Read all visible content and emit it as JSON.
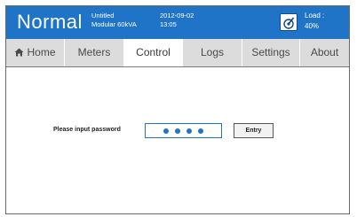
{
  "header": {
    "mode": "Normal",
    "project_name": "Untitled",
    "model": "Modular 60kVA",
    "date": "2012-09-02",
    "time": "13:05",
    "load_label": "Load :",
    "load_value": "40%",
    "load_icon": "load-gauge-icon",
    "colors": {
      "bar": "#1f74c8",
      "text": "#ffffff"
    }
  },
  "tabs": [
    {
      "label": "Home",
      "icon": "home-icon",
      "active": false
    },
    {
      "label": "Meters",
      "active": false
    },
    {
      "label": "Control",
      "active": true
    },
    {
      "label": "Logs",
      "active": false
    },
    {
      "label": "Settings",
      "active": false
    },
    {
      "label": "About",
      "active": false
    }
  ],
  "login": {
    "prompt": "Please input password",
    "masked_length": 4,
    "entry_label": "Entry"
  }
}
